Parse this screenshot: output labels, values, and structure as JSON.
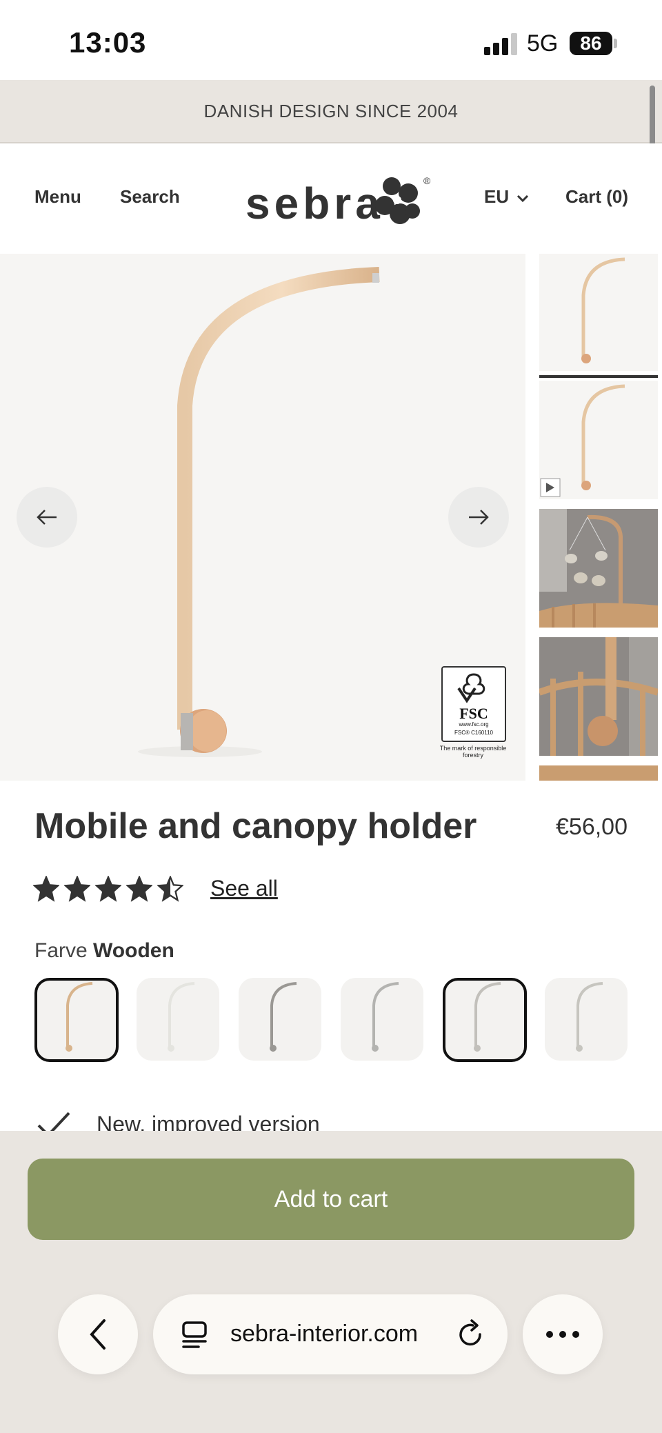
{
  "status_bar": {
    "time": "13:03",
    "network": "5G",
    "battery": "86"
  },
  "banner": {
    "text": "DANISH DESIGN SINCE 2004"
  },
  "nav": {
    "menu": "Menu",
    "search": "Search",
    "logo": "sebra",
    "region": "EU",
    "cart": "Cart (0)"
  },
  "gallery": {
    "fsc_caption": "The mark of responsible forestry",
    "fsc_code": "FSC® C160110",
    "fsc_url": "www.fsc.org",
    "fsc_label": "FSC"
  },
  "product": {
    "title": "Mobile and canopy holder",
    "price": "€56,00",
    "rating": 4.5,
    "see_all": "See all",
    "color_label": "Farve",
    "color_value": "Wooden",
    "swatches": [
      {
        "color": "#d8b48c",
        "selected": true
      },
      {
        "color": "#e4e4df",
        "selected": false
      },
      {
        "color": "#9a9894",
        "selected": false
      },
      {
        "color": "#b3b3b0",
        "selected": false
      },
      {
        "color": "#c2c0bb",
        "selected": true
      },
      {
        "color": "#c6c5bf",
        "selected": false
      }
    ],
    "feature": "New, improved version"
  },
  "actions": {
    "add_to_cart": "Add to cart"
  },
  "browser": {
    "url": "sebra-interior.com"
  }
}
